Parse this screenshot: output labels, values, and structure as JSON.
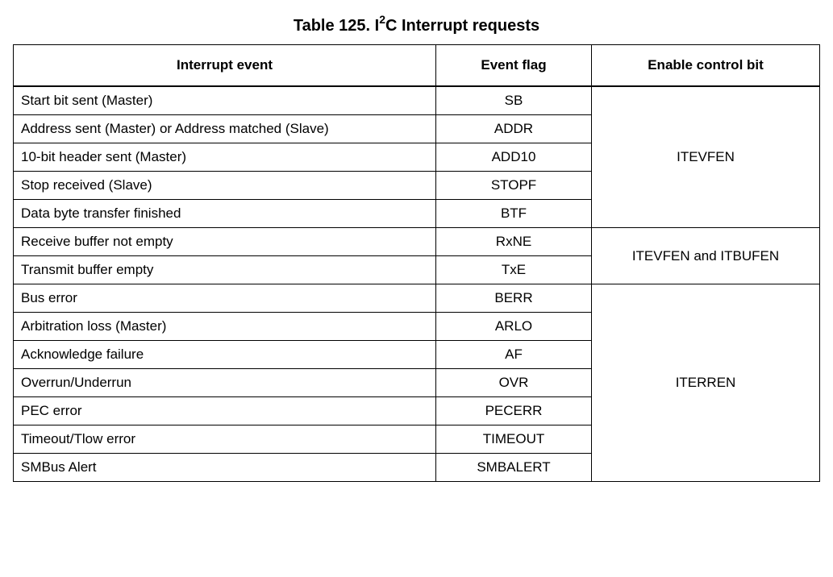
{
  "title": {
    "prefix": "Table 125. I",
    "superscript": "2",
    "suffix": "C Interrupt requests"
  },
  "columns": [
    "Interrupt event",
    "Event flag",
    "Enable control bit"
  ],
  "groups": [
    {
      "enable": "ITEVFEN",
      "rows": [
        {
          "event": "Start bit sent (Master)",
          "flag": "SB"
        },
        {
          "event": "Address sent (Master) or Address matched (Slave)",
          "flag": "ADDR"
        },
        {
          "event": "10-bit header sent (Master)",
          "flag": "ADD10"
        },
        {
          "event": "Stop received (Slave)",
          "flag": "STOPF"
        },
        {
          "event": "Data byte transfer finished",
          "flag": "BTF"
        }
      ]
    },
    {
      "enable": "ITEVFEN and ITBUFEN",
      "rows": [
        {
          "event": "Receive buffer not empty",
          "flag": "RxNE"
        },
        {
          "event": "Transmit buffer empty",
          "flag": "TxE"
        }
      ]
    },
    {
      "enable": "ITERREN",
      "rows": [
        {
          "event": "Bus error",
          "flag": "BERR"
        },
        {
          "event": "Arbitration loss (Master)",
          "flag": "ARLO"
        },
        {
          "event": "Acknowledge failure",
          "flag": "AF"
        },
        {
          "event": "Overrun/Underrun",
          "flag": "OVR"
        },
        {
          "event": "PEC error",
          "flag": "PECERR"
        },
        {
          "event": "Timeout/Tlow error",
          "flag": "TIMEOUT"
        },
        {
          "event": "SMBus Alert",
          "flag": "SMBALERT"
        }
      ]
    }
  ]
}
